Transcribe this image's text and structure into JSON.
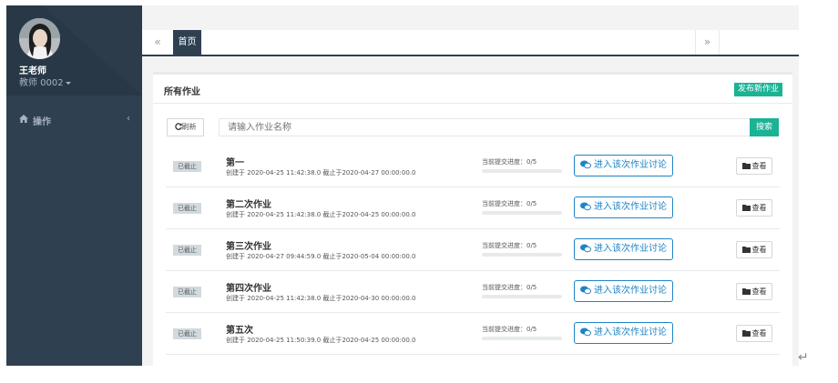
{
  "sidebar": {
    "user_name": "王老师",
    "user_role": "教师 0002",
    "nav_items": [
      {
        "label": "操作",
        "icon": "home-icon",
        "chevron": "‹"
      }
    ]
  },
  "tabs": {
    "prev": "«",
    "home": "首页",
    "next": "»"
  },
  "panel": {
    "title": "所有作业",
    "publish_label": "发布新作业",
    "refresh_label": "刷新",
    "search_placeholder": "请输入作业名称",
    "search_label": "搜索"
  },
  "homeworks": [
    {
      "status": "已截止",
      "title": "第一",
      "meta": "创建于 2020-04-25 11:42:38.0 截止于2020-04-27 00:00:00.0",
      "progress_label": "当前提交进度：0/5",
      "progress": 0,
      "discuss_label": "进入该次作业讨论",
      "view_label": "查看"
    },
    {
      "status": "已截止",
      "title": "第二次作业",
      "meta": "创建于 2020-04-25 11:42:38.0 截止于2020-04-25 00:00:00.0",
      "progress_label": "当前提交进度：0/5",
      "progress": 0,
      "discuss_label": "进入该次作业讨论",
      "view_label": "查看"
    },
    {
      "status": "已截止",
      "title": "第三次作业",
      "meta": "创建于 2020-04-27 09:44:59.0 截止于2020-05-04 00:00:00.0",
      "progress_label": "当前提交进度：0/5",
      "progress": 0,
      "discuss_label": "进入该次作业讨论",
      "view_label": "查看"
    },
    {
      "status": "已截止",
      "title": "第四次作业",
      "meta": "创建于 2020-04-25 11:42:38.0 截止于2020-04-30 00:00:00.0",
      "progress_label": "当前提交进度：0/5",
      "progress": 0,
      "discuss_label": "进入该次作业讨论",
      "view_label": "查看"
    },
    {
      "status": "已截止",
      "title": "第五次",
      "meta": "创建于 2020-04-25 11:50:39.0 截止于2020-04-25 00:00:00.0",
      "progress_label": "当前提交进度：0/5",
      "progress": 0,
      "discuss_label": "进入该次作业讨论",
      "view_label": "查看"
    }
  ],
  "colors": {
    "sidebar": "#2f4050",
    "primary": "#1ab394",
    "info": "#1c84c6"
  },
  "return_glyph": "↵"
}
